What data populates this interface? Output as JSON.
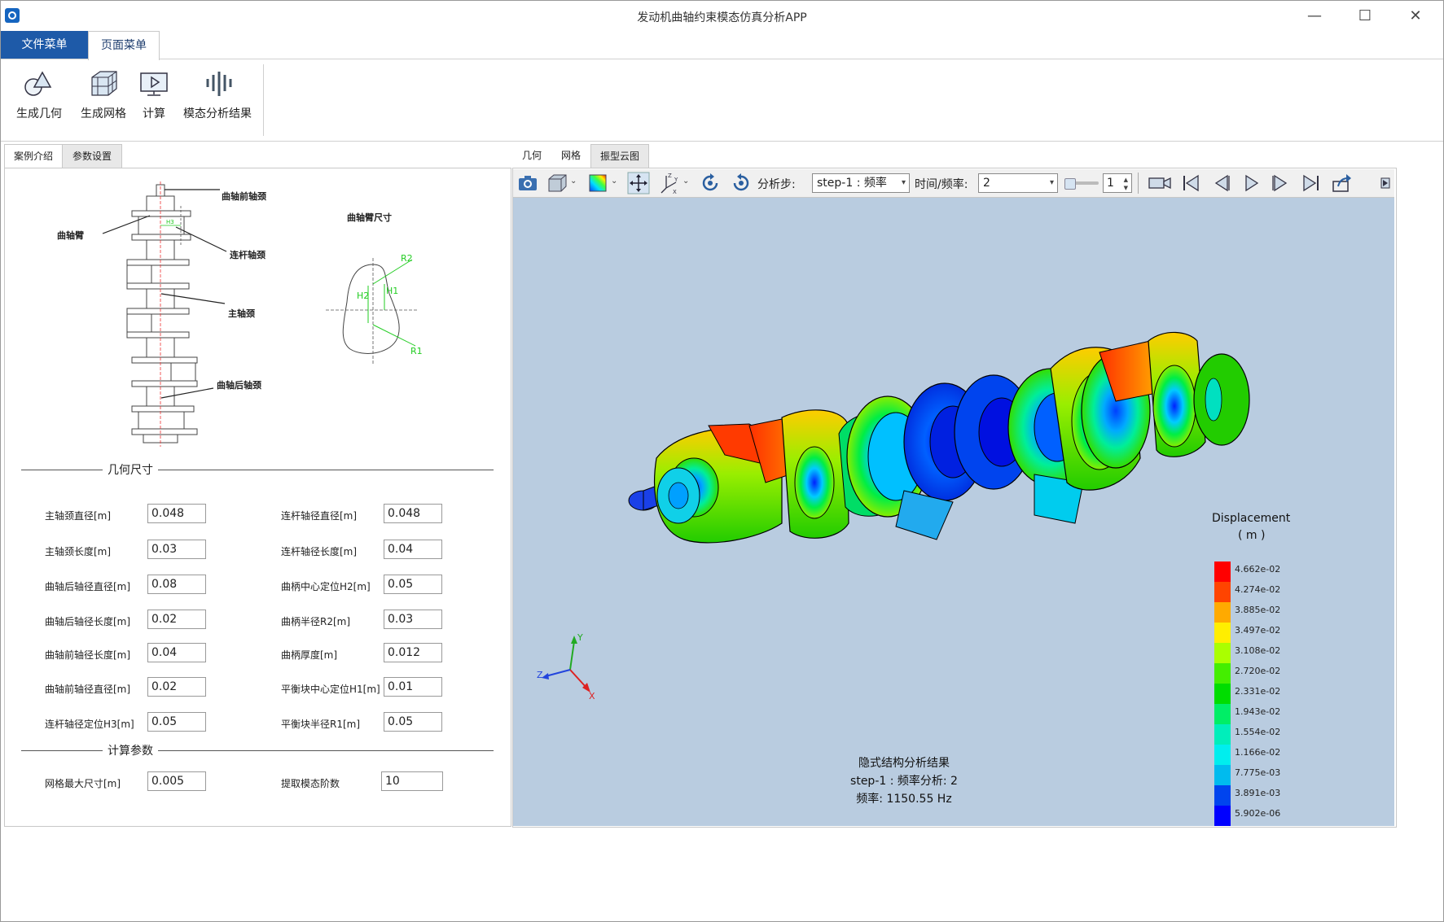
{
  "window": {
    "title": "发动机曲轴约束模态仿真分析APP",
    "minimize": "—",
    "maximize": "☐",
    "close": "✕"
  },
  "menu": {
    "tabs": [
      {
        "label": "文件菜单",
        "active": false
      },
      {
        "label": "页面菜单",
        "active": true
      }
    ]
  },
  "ribbon": {
    "buttons": [
      {
        "label": "生成几何",
        "icon": "geometry-icon"
      },
      {
        "label": "生成网格",
        "icon": "mesh-icon"
      },
      {
        "label": "计算",
        "icon": "compute-icon"
      },
      {
        "label": "模态分析结果",
        "icon": "modal-result-icon"
      }
    ]
  },
  "left_panel": {
    "tabs": [
      {
        "label": "案例介绍"
      },
      {
        "label": "参数设置"
      }
    ],
    "diagram": {
      "front_journal": "曲轴前轴颈",
      "crank_arm": "曲轴臂",
      "conrod_journal": "连杆轴颈",
      "main_journal": "主轴颈",
      "rear_journal": "曲轴后轴颈",
      "arm_size_title": "曲轴臂尺寸",
      "h3": "H3",
      "h1": "H1",
      "h2": "H2",
      "r1": "R1",
      "r2": "R2"
    },
    "geometry_section": "几何尺寸",
    "calc_section": "计算参数",
    "params": [
      {
        "label": "主轴颈直径[m]",
        "value": "0.048"
      },
      {
        "label": "连杆轴径直径[m]",
        "value": "0.048"
      },
      {
        "label": "主轴颈长度[m]",
        "value": "0.03"
      },
      {
        "label": "连杆轴径长度[m]",
        "value": "0.04"
      },
      {
        "label": "曲轴后轴径直径[m]",
        "value": "0.08"
      },
      {
        "label": "曲柄中心定位H2[m]",
        "value": "0.05"
      },
      {
        "label": "曲轴后轴径长度[m]",
        "value": "0.02"
      },
      {
        "label": "曲柄半径R2[m]",
        "value": "0.03"
      },
      {
        "label": "曲轴前轴径长度[m]",
        "value": "0.04"
      },
      {
        "label": "曲柄厚度[m]",
        "value": "0.012"
      },
      {
        "label": "曲轴前轴径直径[m]",
        "value": "0.02"
      },
      {
        "label": "平衡块中心定位H1[m]",
        "value": "0.01"
      },
      {
        "label": "连杆轴径定位H3[m]",
        "value": "0.05"
      },
      {
        "label": "平衡块半径R1[m]",
        "value": "0.05"
      }
    ],
    "calc_params": [
      {
        "label": "网格最大尺寸[m]",
        "value": "0.005"
      },
      {
        "label": "提取模态阶数",
        "value": "10"
      }
    ]
  },
  "right_panel": {
    "tabs": [
      {
        "label": "几何",
        "active": false
      },
      {
        "label": "网格",
        "active": false
      },
      {
        "label": "振型云图",
        "active": true
      }
    ],
    "toolbar": {
      "step_label": "分析步:",
      "step_value": "step-1 : 频率",
      "time_label": "时间/频率:",
      "time_value": "2",
      "frame_value": "1"
    },
    "result_text": {
      "line1": "隐式结构分析结果",
      "line2": "step-1 : 频率分析: 2",
      "line3": "频率:  1150.55 Hz"
    },
    "legend": {
      "title": "Displacement",
      "unit": "( m )",
      "ticks": [
        "4.662e-02",
        "4.274e-02",
        "3.885e-02",
        "3.497e-02",
        "3.108e-02",
        "2.720e-02",
        "2.331e-02",
        "1.943e-02",
        "1.554e-02",
        "1.166e-02",
        "7.775e-03",
        "3.891e-03",
        "5.902e-06"
      ],
      "colors": [
        "#ff0000",
        "#ff4400",
        "#ffaa00",
        "#ffee00",
        "#aaff00",
        "#44ee00",
        "#00dd00",
        "#00ee66",
        "#00eebb",
        "#00eeee",
        "#00bbee",
        "#0044ee",
        "#0000ff"
      ]
    },
    "axes": {
      "x": "X",
      "y": "Y",
      "z": "Z"
    }
  }
}
